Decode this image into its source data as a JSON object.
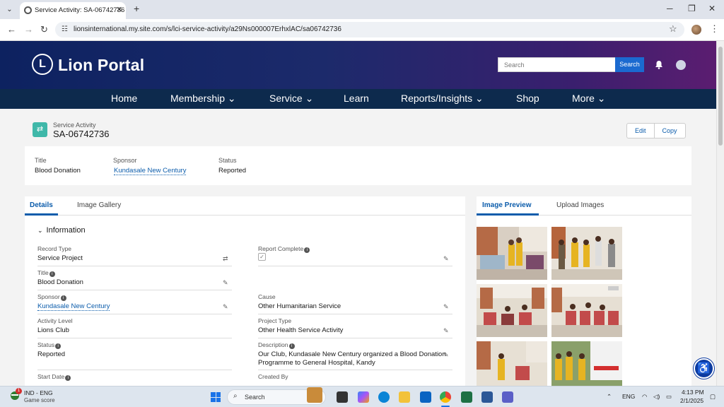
{
  "browser": {
    "tab_title": "Service Activity: SA-06742736",
    "url": "lionsinternational.my.site.com/s/lci-service-activity/a29Ns000007ErhxlAC/sa06742736",
    "new_tab_symbol": "+",
    "close_symbol": "✕"
  },
  "header": {
    "logo_letter": "L",
    "logo_text": "Lion Portal",
    "search_placeholder": "Search",
    "search_button": "Search"
  },
  "nav": {
    "items": [
      {
        "label": "Home"
      },
      {
        "label": "Membership ⌄"
      },
      {
        "label": "Service ⌄"
      },
      {
        "label": "Learn"
      },
      {
        "label": "Reports/Insights ⌄"
      },
      {
        "label": "Shop"
      },
      {
        "label": "More ⌄"
      }
    ]
  },
  "record": {
    "type_label": "Service Activity",
    "name": "SA-06742736",
    "edit_button": "Edit",
    "copy_button": "Copy"
  },
  "highlights": {
    "title_label": "Title",
    "title_value": "Blood Donation",
    "sponsor_label": "Sponsor",
    "sponsor_value": "Kundasale New Century",
    "status_label": "Status",
    "status_value": "Reported"
  },
  "details": {
    "tabs": [
      "Details",
      "Image Gallery"
    ],
    "section_title": "Information",
    "left_fields": [
      {
        "label": "Record Type",
        "value": "Service Project"
      },
      {
        "label": "Title",
        "value": "Blood Donation"
      },
      {
        "label": "Sponsor",
        "value": "Kundasale New Century"
      },
      {
        "label": "Activity Level",
        "value": "Lions Club"
      },
      {
        "label": "Status",
        "value": "Reported"
      },
      {
        "label": "Start Date",
        "value": ""
      }
    ],
    "right_fields": [
      {
        "label": "Report Complete",
        "value": ""
      },
      {
        "label": "Cause",
        "value": "Other Humanitarian Service"
      },
      {
        "label": "Project Type",
        "value": "Other Health Service Activity"
      },
      {
        "label": "Description",
        "value": "Our Club, Kundasale New Century organized a Blood Donation",
        "value2": "Programme to General Hospital, Kandy"
      },
      {
        "label": "Created By",
        "value": ""
      }
    ]
  },
  "gallery": {
    "tabs": [
      "Image Preview",
      "Upload Images"
    ]
  },
  "taskbar": {
    "notification_count": "1",
    "weather_line1": "IND - ENG",
    "weather_line2": "Game score",
    "search_placeholder": "Search",
    "language": "ENG",
    "time": "4:13 PM",
    "date": "2/1/2025"
  },
  "colors": {
    "accent": "#0b5cab",
    "nav_bg": "#0d2a4d",
    "record_icon": "#3fb8a9"
  }
}
